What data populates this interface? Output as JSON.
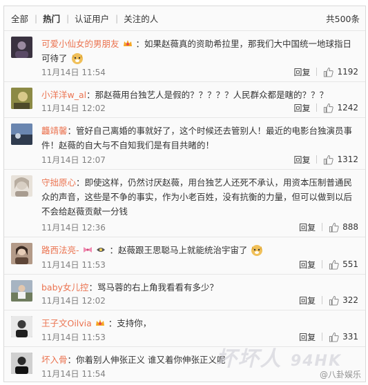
{
  "tabs": [
    {
      "label": "全部",
      "active": false
    },
    {
      "label": "热门",
      "active": true
    },
    {
      "label": "认证用户",
      "active": false
    },
    {
      "label": "关注的人",
      "active": false
    }
  ],
  "total": "共500条",
  "reply_label": "回复",
  "comments": [
    {
      "user": "可爱小仙女的男朋友",
      "text": "：如果赵薇真的资助希拉里，那我们大中国统一地球指日可待了",
      "time": "11月14日 11:54",
      "likes": "1192",
      "avatar_color": "#3a3240"
    },
    {
      "user": "小洋洋w_al",
      "text": "：那赵薇用台独艺人是假的？？？？？人民群众都是瞎的？？？",
      "time": "11月14日 12:02",
      "likes": "1242",
      "avatar_color": "#6b6a3a"
    },
    {
      "user": "龘靖馨",
      "text": "：管好自己离婚的事就好了，这个时候还去管别人！最近的电影台独演员事件！赵薇的自大与不自知我们是有目共睹的！",
      "time": "11月14日 12:07",
      "likes": "1312",
      "avatar_color": "#4a5a78"
    },
    {
      "user": "守拙原心",
      "text": "：即使这样，仍然讨厌赵薇，用台独艺人还死不承认，用资本压制普通民众的声音，这些是不争的事实，作为小老百姓，没有抗衡的力量，但可以做到以后不会给赵薇贡献一分钱",
      "time": "11月14日 12:36",
      "likes": "888",
      "avatar_color": "#c9c2b8"
    },
    {
      "user": "路西法亮-",
      "text": "：赵薇跟王思聪马上就能统治宇宙了",
      "time": "11月14日 11:53",
      "likes": "551",
      "avatar_color": "#8a7466"
    },
    {
      "user": "baby女儿控",
      "text": "：骂马蓉的右上角我看看有多少？",
      "time": "11月14日 12:02",
      "likes": "322",
      "avatar_color": "#7f8a70"
    },
    {
      "user": "王子文Oilvia",
      "text": "：支持你，",
      "time": "11月14日 11:53",
      "likes": "331",
      "avatar_color": "#2e2e2e"
    },
    {
      "user": "坏入骨",
      "text": "：你着别人伸张正义 谁又着你伸张正义呢",
      "time": "11月14日 11:54",
      "likes": "",
      "avatar_color": "#1f1f1f"
    }
  ],
  "watermark": {
    "main": "坏坏人",
    "site": "94HK",
    "credit": "@八卦娱乐"
  }
}
